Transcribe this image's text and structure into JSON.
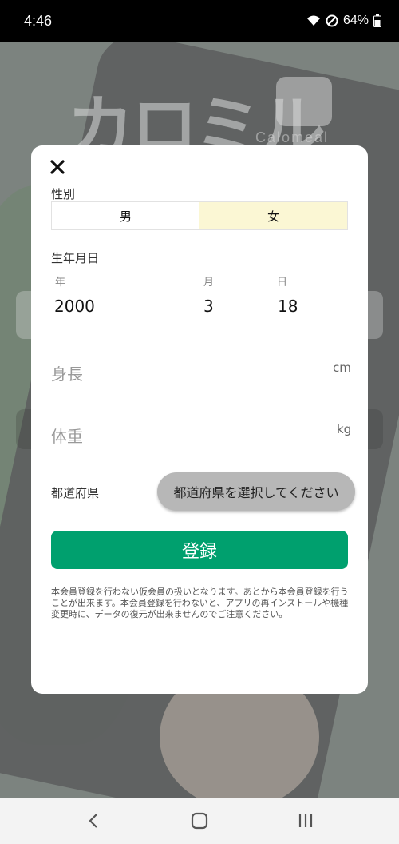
{
  "status_bar": {
    "time": "4:46",
    "battery": "64%",
    "icons": [
      "wifi-icon",
      "do-not-disturb-icon",
      "battery-icon"
    ]
  },
  "background": {
    "logo_text": "カロミル",
    "logo_sub": "Calomeal"
  },
  "modal": {
    "gender_label": "性別",
    "gender_options": [
      "男",
      "女"
    ],
    "gender_selected": "女",
    "birthdate_label": "生年月日",
    "year_label": "年",
    "month_label": "月",
    "day_label": "日",
    "year_value": "2000",
    "month_value": "3",
    "day_value": "18",
    "height_placeholder": "身長",
    "height_unit": "cm",
    "weight_placeholder": "体重",
    "weight_unit": "kg",
    "prefecture_label": "都道府県",
    "prefecture_button": "都道府県を選択してください",
    "register_button": "登録",
    "notice": "本会員登録を行わない仮会員の扱いとなります。あとから本会員登録を行うことが出来ます。本会員登録を行わないと、アプリの再インストールや機種変更時に、データの復元が出来ませんのでご注意ください。"
  },
  "colors": {
    "accent": "#00a06e",
    "selected_gender": "#fbf7d4",
    "prefecture_button": "#b7b7b7"
  }
}
